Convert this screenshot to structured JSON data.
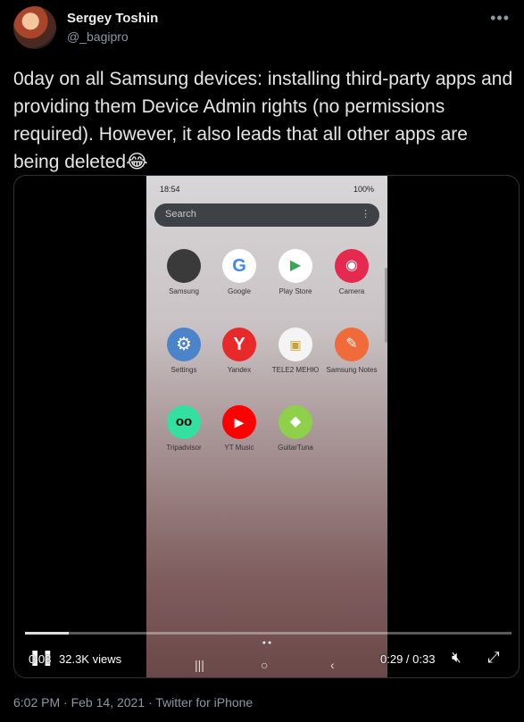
{
  "author": {
    "name": "Sergey Toshin",
    "handle": "@_bagipro"
  },
  "tweet": {
    "text": "0day on all Samsung devices: installing third-party apps and providing them Device Admin rights (no permissions required). However, it also leads that all other apps are being deleted😂",
    "footer": "6:02 PM · Feb 14, 2021 · Twitter for iPhone"
  },
  "phone": {
    "time": "18:54",
    "status_right": "100%",
    "search_placeholder": "Search",
    "apps": [
      {
        "label": "Samsung",
        "icon": "samsung-folder-icon",
        "color": "#3a3a3a"
      },
      {
        "label": "Google",
        "icon": "google-icon",
        "color": "#ffffff"
      },
      {
        "label": "Play Store",
        "icon": "play-store-icon",
        "color": "#ffffff"
      },
      {
        "label": "Camera",
        "icon": "camera-icon",
        "color": "#e5294f"
      },
      {
        "label": "Settings",
        "icon": "gear-icon",
        "color": "#4c84c9"
      },
      {
        "label": "Yandex",
        "icon": "yandex-icon",
        "color": "#e8292a"
      },
      {
        "label": "TELE2 МЕНЮ",
        "icon": "sim-card-icon",
        "color": "#f4f4f4"
      },
      {
        "label": "Samsung Notes",
        "icon": "notes-icon",
        "color": "#f06a3a"
      },
      {
        "label": "Tripadvisor",
        "icon": "owl-icon",
        "color": "#34e0a1"
      },
      {
        "label": "YT Music",
        "icon": "yt-music-icon",
        "color": "#ff0000"
      },
      {
        "label": "GuitarTuna",
        "icon": "guitartuna-icon",
        "color": "#8ed04a"
      }
    ]
  },
  "video": {
    "current": "0:03",
    "views": "32.3K views",
    "remaining": "0:29 / 0:33",
    "progress": 0.09
  }
}
